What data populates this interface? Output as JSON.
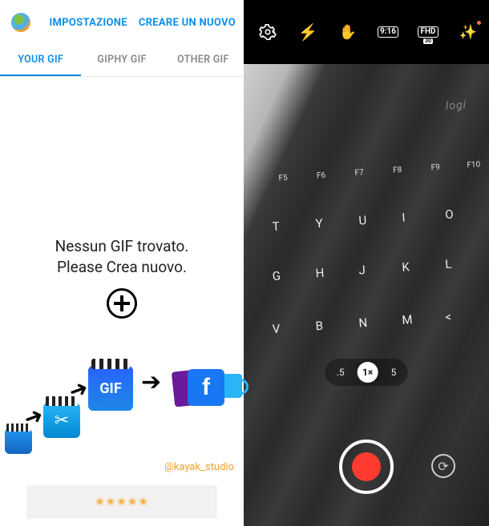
{
  "gifApp": {
    "header": {
      "settings": "IMPOSTAZIONE",
      "create": "CREARE UN NUOVO"
    },
    "tabs": [
      {
        "label": "YOUR GIF",
        "active": true
      },
      {
        "label": "GIPHY GIF",
        "active": false
      },
      {
        "label": "OTHER GIF",
        "active": false
      }
    ],
    "empty": {
      "line1": "Nessun GIF trovato.",
      "line2": "Please Crea nuovo."
    },
    "gifBadge": "GIF",
    "fbBadge": "f",
    "credit": "@kayak_studio"
  },
  "camera": {
    "topIcons": {
      "settings": "⚙",
      "flash": "⚡",
      "palm": "✋",
      "ratio": "9:16",
      "fhd": "FHD",
      "filters": "✨"
    },
    "brand": "logi",
    "fnKeys": [
      "F5",
      "F6",
      "F7",
      "F8",
      "F9",
      "F10"
    ],
    "row1": [
      "T",
      "Y",
      "U",
      "I",
      "O"
    ],
    "row2": [
      "G",
      "H",
      "J",
      "K",
      "L"
    ],
    "row3": [
      "V",
      "B",
      "N",
      "M",
      "<"
    ],
    "zoom": [
      {
        "label": ".5",
        "active": false
      },
      {
        "label": "1×",
        "active": true
      },
      {
        "label": "5",
        "active": false
      }
    ],
    "switchIcon": "⟳"
  }
}
